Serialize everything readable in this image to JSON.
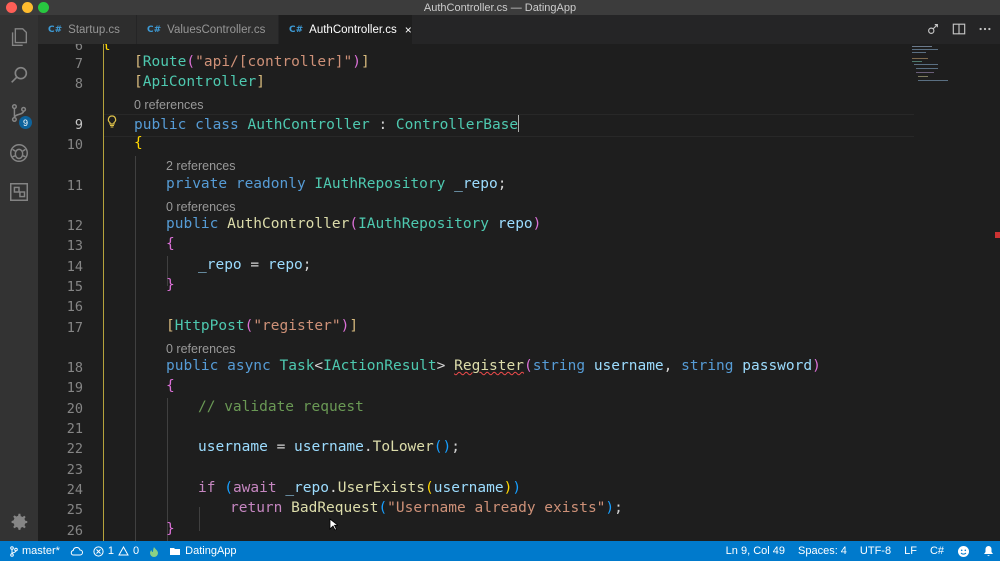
{
  "window": {
    "title": "AuthController.cs — DatingApp"
  },
  "activity": {
    "scm_badge": "9"
  },
  "tabs": [
    {
      "icon": "C#",
      "label": "Startup.cs"
    },
    {
      "icon": "C#",
      "label": "ValuesController.cs"
    },
    {
      "icon": "C#",
      "label": "AuthController.cs",
      "close": "×"
    }
  ],
  "editor": {
    "partial_line_number": "6",
    "lines": [
      {
        "num": "7",
        "text": "[Route(\"api/[controller]\")]"
      },
      {
        "num": "8",
        "text": "[ApiController]"
      },
      {
        "num": "9",
        "text": "public class AuthController : ControllerBase"
      },
      {
        "num": "10",
        "text": "{"
      },
      {
        "num": "11",
        "text": "private readonly IAuthRepository _repo;"
      },
      {
        "num": "12",
        "text": "public AuthController(IAuthRepository repo)"
      },
      {
        "num": "13",
        "text": "{"
      },
      {
        "num": "14",
        "text": "_repo = repo;"
      },
      {
        "num": "15",
        "text": "}"
      },
      {
        "num": "16",
        "text": ""
      },
      {
        "num": "17",
        "text": "[HttpPost(\"register\")]"
      },
      {
        "num": "18",
        "text": "public async Task<IActionResult> Register(string username, string password)"
      },
      {
        "num": "19",
        "text": "{"
      },
      {
        "num": "20",
        "text": "// validate request"
      },
      {
        "num": "21",
        "text": ""
      },
      {
        "num": "22",
        "text": "username = username.ToLower();"
      },
      {
        "num": "23",
        "text": ""
      },
      {
        "num": "24",
        "text": "if (await _repo.UserExists(username))"
      },
      {
        "num": "25",
        "text": "return BadRequest(\"Username already exists\");"
      },
      {
        "num": "26",
        "text": "}"
      }
    ],
    "codelens": {
      "class_refs": "0 references",
      "repo_refs": "2 references",
      "ctor_refs": "0 references",
      "register_refs": "0 references"
    }
  },
  "statusbar": {
    "branch": "master*",
    "errors": "1",
    "warnings": "0",
    "project": "DatingApp",
    "position": "Ln 9, Col 49",
    "spaces": "Spaces: 4",
    "encoding": "UTF-8",
    "eol": "LF",
    "language": "C#"
  },
  "colors": {
    "accent": "#007acc",
    "keyword": "#569cd6",
    "type": "#4ec9b0",
    "string": "#ce9178",
    "function": "#dcdcaa",
    "comment": "#6a9955"
  }
}
